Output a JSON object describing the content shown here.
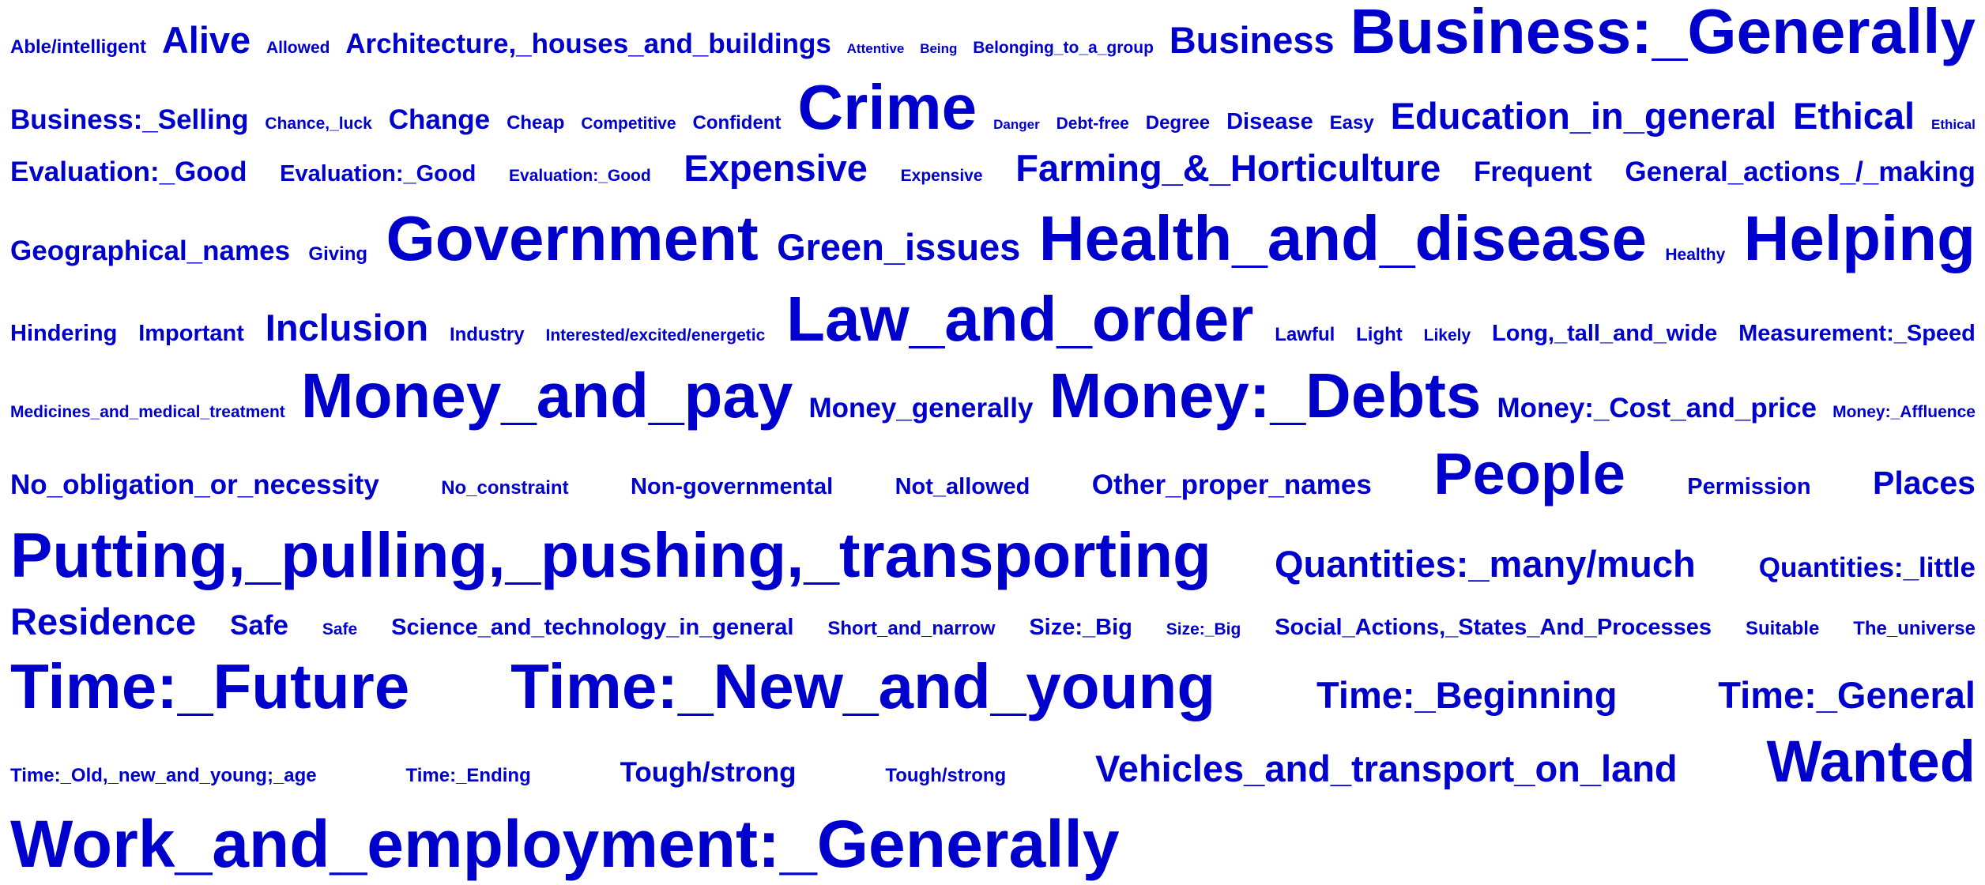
{
  "rows": [
    [
      {
        "text": "Able/intelligent",
        "size": 3
      },
      {
        "text": "Alive",
        "size": 7
      },
      {
        "text": "Allowed",
        "size": 2
      },
      {
        "text": "Architecture,_houses_and_buildings",
        "size": 5
      },
      {
        "text": "Attentive",
        "size": 1
      },
      {
        "text": "Being",
        "size": 1
      },
      {
        "text": "Belonging_to_a_group",
        "size": 2
      },
      {
        "text": "Business",
        "size": 7
      },
      {
        "text": "Business:_Generally",
        "size": 11
      }
    ],
    [
      {
        "text": "Business:_Selling",
        "size": 5
      },
      {
        "text": "Chance,_luck",
        "size": 2
      },
      {
        "text": "Change",
        "size": 5
      },
      {
        "text": "Cheap",
        "size": 3
      },
      {
        "text": "Competitive",
        "size": 2
      },
      {
        "text": "Confident",
        "size": 3
      },
      {
        "text": "Crime",
        "size": 11
      },
      {
        "text": "Danger",
        "size": 1
      },
      {
        "text": "Debt-free",
        "size": 2
      },
      {
        "text": "Degree",
        "size": 3
      },
      {
        "text": "Disease",
        "size": 4
      },
      {
        "text": "Easy",
        "size": 3
      },
      {
        "text": "Education_in_general",
        "size": 7
      },
      {
        "text": "Ethical",
        "size": 7
      },
      {
        "text": "Ethical",
        "size": 1
      }
    ],
    [
      {
        "text": "Evaluation:_Good",
        "size": 5
      },
      {
        "text": "Evaluation:_Good",
        "size": 4
      },
      {
        "text": "Evaluation:_Good",
        "size": 2
      },
      {
        "text": "Expensive",
        "size": 7
      },
      {
        "text": "Expensive",
        "size": 2
      },
      {
        "text": "Farming_&_Horticulture",
        "size": 7
      },
      {
        "text": "Frequent",
        "size": 5
      },
      {
        "text": "General_actions_/_making",
        "size": 5
      }
    ],
    [
      {
        "text": "Geographical_names",
        "size": 5
      },
      {
        "text": "Giving",
        "size": 3
      },
      {
        "text": "Government",
        "size": 11
      },
      {
        "text": "Green_issues",
        "size": 7
      },
      {
        "text": "Health_and_disease",
        "size": 11
      },
      {
        "text": "Healthy",
        "size": 2
      },
      {
        "text": "Helping",
        "size": 11
      }
    ],
    [
      {
        "text": "Hindering",
        "size": 4
      },
      {
        "text": "Important",
        "size": 4
      },
      {
        "text": "Inclusion",
        "size": 7
      },
      {
        "text": "Industry",
        "size": 3
      },
      {
        "text": "Interested/excited/energetic",
        "size": 2
      },
      {
        "text": "Law_and_order",
        "size": 11
      },
      {
        "text": "Lawful",
        "size": 3
      },
      {
        "text": "Light",
        "size": 3
      },
      {
        "text": "Likely",
        "size": 2
      },
      {
        "text": "Long,_tall_and_wide",
        "size": 4
      },
      {
        "text": "Measurement:_Speed",
        "size": 4
      }
    ],
    [
      {
        "text": "Medicines_and_medical_treatment",
        "size": 2
      },
      {
        "text": "Money_and_pay",
        "size": 11
      },
      {
        "text": "Money_generally",
        "size": 5
      },
      {
        "text": "Money:_Debts",
        "size": 11
      },
      {
        "text": "Money:_Cost_and_price",
        "size": 5
      },
      {
        "text": "Money:_Affluence",
        "size": 2
      }
    ],
    [
      {
        "text": "No_obligation_or_necessity",
        "size": 5
      },
      {
        "text": "No_constraint",
        "size": 3
      },
      {
        "text": "Non-governmental",
        "size": 4
      },
      {
        "text": "Not_allowed",
        "size": 4
      },
      {
        "text": "Other_proper_names",
        "size": 5
      },
      {
        "text": "People",
        "size": 10
      },
      {
        "text": "Permission",
        "size": 4
      },
      {
        "text": "Places",
        "size": 6
      }
    ],
    [
      {
        "text": "Putting,_pulling,_pushing,_transporting",
        "size": 11
      },
      {
        "text": "Quantities:_many/much",
        "size": 7
      },
      {
        "text": "Quantities:_little",
        "size": 5
      }
    ],
    [
      {
        "text": "Residence",
        "size": 7
      },
      {
        "text": "Safe",
        "size": 5
      },
      {
        "text": "Safe",
        "size": 2
      },
      {
        "text": "Science_and_technology_in_general",
        "size": 4
      },
      {
        "text": "Short_and_narrow",
        "size": 3
      },
      {
        "text": "Size:_Big",
        "size": 4
      },
      {
        "text": "Size:_Big",
        "size": 2
      },
      {
        "text": "Social_Actions,_States_And_Processes",
        "size": 4
      },
      {
        "text": "Suitable",
        "size": 3
      },
      {
        "text": "The_universe",
        "size": 3
      }
    ],
    [
      {
        "text": "Time:_Future",
        "size": 11
      },
      {
        "text": "Time:_New_and_young",
        "size": 11
      },
      {
        "text": "Time:_Beginning",
        "size": 7
      },
      {
        "text": "Time:_General",
        "size": 7
      }
    ],
    [
      {
        "text": "Time:_Old,_new_and_young;_age",
        "size": 3
      },
      {
        "text": "Time:_Ending",
        "size": 3
      },
      {
        "text": "Tough/strong",
        "size": 5
      },
      {
        "text": "Tough/strong",
        "size": 3
      },
      {
        "text": "Vehicles_and_transport_on_land",
        "size": 7
      },
      {
        "text": "Wanted",
        "size": 10
      }
    ],
    [
      {
        "text": "Work_and_employment:_Generally",
        "size": 12
      }
    ]
  ],
  "colors": {
    "word": "#0000cc",
    "background": "#ffffff"
  }
}
